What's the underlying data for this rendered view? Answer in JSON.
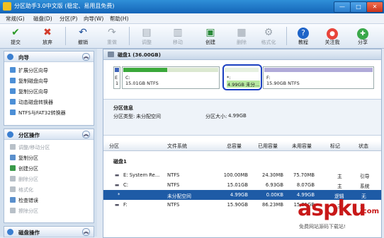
{
  "window": {
    "title": "分区助手3.0中文版 (稳定、易用且免费)",
    "min": "—",
    "max": "□",
    "close": "✕"
  },
  "menu": [
    "常规(G)",
    "磁盘(D)",
    "分区(P)",
    "向导(W)",
    "帮助(H)"
  ],
  "toolbar": {
    "submit": "提交",
    "discard": "放弃",
    "undo": "撤销",
    "redo": "重做",
    "adjust": "调整",
    "move": "移动",
    "create": "创建",
    "delete": "删除",
    "format": "格式化",
    "tutorial": "教程",
    "follow": "关注我",
    "share": "分享"
  },
  "wizard": {
    "title": "向导",
    "items": [
      "扩展分区向导",
      "复制磁盘向导",
      "复制分区向导",
      "动态磁盘转换器",
      "NTFS与FAT32转换器"
    ]
  },
  "ops": {
    "title": "分区操作",
    "items": [
      "调整/移动分区",
      "复制分区",
      "创建分区",
      "删除分区",
      "格式化",
      "检查错误",
      "擦除分区"
    ]
  },
  "disk_ops": {
    "title": "磁盘操作"
  },
  "disk": {
    "label": "磁盘1 (36.00GB)",
    "segments": [
      {
        "letter": "E",
        "num": "1",
        "name": "C:",
        "detail": "15.01GB NTFS"
      },
      {
        "name": "*:",
        "detail": "4.99GB 未分..."
      },
      {
        "name": "F:",
        "detail": "15.90GB NTFS"
      }
    ]
  },
  "partition_info": {
    "title": "分区信息",
    "type_label": "分区类型:",
    "type_value": "未分配空间",
    "size_label": "分区大小:",
    "size_value": "4.99GB"
  },
  "table": {
    "headers": [
      "分区",
      "文件系统",
      "总容量",
      "已用容量",
      "未用容量",
      "标记",
      "状态"
    ],
    "disk_group": "磁盘1",
    "rows": [
      {
        "name": "E:  System Re...",
        "fs": "NTFS",
        "total": "100.00MB",
        "used": "24.30MB",
        "free": "75.70MB",
        "flag": "主",
        "status": "引导"
      },
      {
        "name": "C:",
        "fs": "NTFS",
        "total": "15.01GB",
        "used": "6.93GB",
        "free": "8.07GB",
        "flag": "主",
        "status": "系统"
      },
      {
        "name": "*",
        "fs": "未分配空间",
        "total": "4.99GB",
        "used": "0.00KB",
        "free": "4.99GB",
        "flag": "逻辑",
        "status": "无"
      },
      {
        "name": "F:",
        "fs": "NTFS",
        "total": "15.90GB",
        "used": "86.23MB",
        "free": "15.81GB",
        "flag": "主",
        "status": "无"
      }
    ]
  },
  "watermark": {
    "brand": "aspku",
    "dotcom": ".com",
    "subtitle": "免费网站源码下载站!"
  }
}
